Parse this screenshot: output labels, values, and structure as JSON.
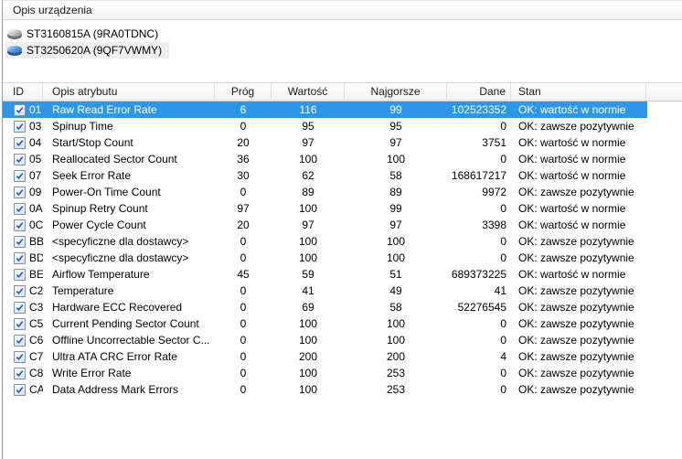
{
  "device_panel": {
    "header": "Opis urządzenia",
    "devices": [
      {
        "name": "ST3160815A (9RA0TDNC)",
        "icon": "disk-gray",
        "selected": false
      },
      {
        "name": "ST3250620A (9QF7VWMY)",
        "icon": "disk-blue",
        "selected": true
      }
    ]
  },
  "attributes_table": {
    "columns": [
      "ID",
      "Opis atrybutu",
      "Próg",
      "Wartość",
      "Najgorsze",
      "Dane",
      "Stan"
    ],
    "rows": [
      {
        "checked": true,
        "selected": true,
        "id": "01",
        "name": "Raw Read Error Rate",
        "prog": "6",
        "wartosc": "116",
        "najgorsze": "99",
        "dane": "102523352",
        "stan": "OK: wartość w normie"
      },
      {
        "checked": true,
        "selected": false,
        "id": "03",
        "name": "Spinup Time",
        "prog": "0",
        "wartosc": "95",
        "najgorsze": "95",
        "dane": "0",
        "stan": "OK: zawsze pozytywnie"
      },
      {
        "checked": true,
        "selected": false,
        "id": "04",
        "name": "Start/Stop Count",
        "prog": "20",
        "wartosc": "97",
        "najgorsze": "97",
        "dane": "3751",
        "stan": "OK: wartość w normie"
      },
      {
        "checked": true,
        "selected": false,
        "id": "05",
        "name": "Reallocated Sector Count",
        "prog": "36",
        "wartosc": "100",
        "najgorsze": "100",
        "dane": "0",
        "stan": "OK: wartość w normie"
      },
      {
        "checked": true,
        "selected": false,
        "id": "07",
        "name": "Seek Error Rate",
        "prog": "30",
        "wartosc": "62",
        "najgorsze": "58",
        "dane": "168617217",
        "stan": "OK: wartość w normie"
      },
      {
        "checked": true,
        "selected": false,
        "id": "09",
        "name": "Power-On Time Count",
        "prog": "0",
        "wartosc": "89",
        "najgorsze": "89",
        "dane": "9972",
        "stan": "OK: zawsze pozytywnie"
      },
      {
        "checked": true,
        "selected": false,
        "id": "0A",
        "name": "Spinup Retry Count",
        "prog": "97",
        "wartosc": "100",
        "najgorsze": "99",
        "dane": "0",
        "stan": "OK: wartość w normie"
      },
      {
        "checked": true,
        "selected": false,
        "id": "0C",
        "name": "Power Cycle Count",
        "prog": "20",
        "wartosc": "97",
        "najgorsze": "97",
        "dane": "3398",
        "stan": "OK: wartość w normie"
      },
      {
        "checked": true,
        "selected": false,
        "id": "BB",
        "name": "<specyficzne dla dostawcy>",
        "prog": "0",
        "wartosc": "100",
        "najgorsze": "100",
        "dane": "0",
        "stan": "OK: zawsze pozytywnie"
      },
      {
        "checked": true,
        "selected": false,
        "id": "BD",
        "name": "<specyficzne dla dostawcy>",
        "prog": "0",
        "wartosc": "100",
        "najgorsze": "100",
        "dane": "0",
        "stan": "OK: zawsze pozytywnie"
      },
      {
        "checked": true,
        "selected": false,
        "id": "BE",
        "name": "Airflow Temperature",
        "prog": "45",
        "wartosc": "59",
        "najgorsze": "51",
        "dane": "689373225",
        "stan": "OK: wartość w normie"
      },
      {
        "checked": true,
        "selected": false,
        "id": "C2",
        "name": "Temperature",
        "prog": "0",
        "wartosc": "41",
        "najgorsze": "49",
        "dane": "41",
        "stan": "OK: zawsze pozytywnie"
      },
      {
        "checked": true,
        "selected": false,
        "id": "C3",
        "name": "Hardware ECC Recovered",
        "prog": "0",
        "wartosc": "69",
        "najgorsze": "58",
        "dane": "52276545",
        "stan": "OK: zawsze pozytywnie"
      },
      {
        "checked": true,
        "selected": false,
        "id": "C5",
        "name": "Current Pending Sector Count",
        "prog": "0",
        "wartosc": "100",
        "najgorsze": "100",
        "dane": "0",
        "stan": "OK: zawsze pozytywnie"
      },
      {
        "checked": true,
        "selected": false,
        "id": "C6",
        "name": "Offline Uncorrectable Sector C...",
        "prog": "0",
        "wartosc": "100",
        "najgorsze": "100",
        "dane": "0",
        "stan": "OK: zawsze pozytywnie"
      },
      {
        "checked": true,
        "selected": false,
        "id": "C7",
        "name": "Ultra ATA CRC Error Rate",
        "prog": "0",
        "wartosc": "200",
        "najgorsze": "200",
        "dane": "4",
        "stan": "OK: zawsze pozytywnie"
      },
      {
        "checked": true,
        "selected": false,
        "id": "C8",
        "name": "Write Error Rate",
        "prog": "0",
        "wartosc": "100",
        "najgorsze": "253",
        "dane": "0",
        "stan": "OK: zawsze pozytywnie"
      },
      {
        "checked": true,
        "selected": false,
        "id": "CA",
        "name": "Data Address Mark Errors",
        "prog": "0",
        "wartosc": "100",
        "najgorsze": "253",
        "dane": "0",
        "stan": "OK: zawsze pozytywnie"
      }
    ]
  },
  "colors": {
    "selection_blue": "#2d96e8",
    "device_selected_bg": "#efefef",
    "header_gradient_bottom": "#f0f1f2",
    "checkbox_check": "#2b4fc4"
  }
}
